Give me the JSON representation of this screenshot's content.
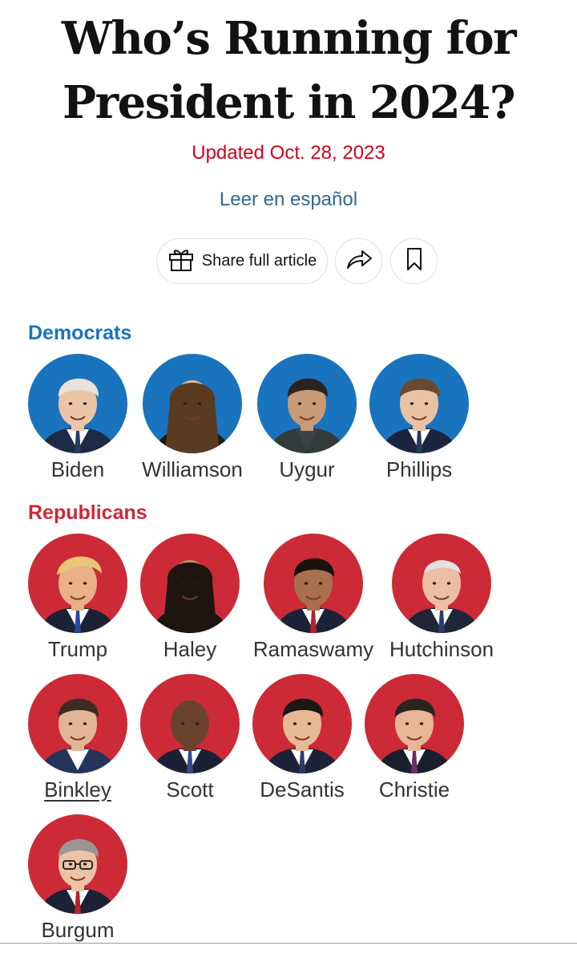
{
  "article": {
    "headline_line1": "Who’s Running for",
    "headline_line2": "President in 2024?",
    "updated": "Updated Oct. 28, 2023",
    "spanish_link": "Leer en español"
  },
  "share": {
    "share_full_label": "Share full article",
    "icons": [
      "gift-icon",
      "share-arrow-icon",
      "bookmark-icon"
    ]
  },
  "colors": {
    "democrat": "#1a73bd",
    "republican": "#cc2a36",
    "updated_text": "#d0021b",
    "link": "#326891"
  },
  "democrats": {
    "heading": "Democrats",
    "candidates": [
      {
        "name": "Biden"
      },
      {
        "name": "Williamson"
      },
      {
        "name": "Uygur"
      },
      {
        "name": "Phillips"
      }
    ]
  },
  "republicans": {
    "heading": "Republicans",
    "candidates": [
      {
        "name": "Trump"
      },
      {
        "name": "Haley"
      },
      {
        "name": "Ramaswamy"
      },
      {
        "name": "Hutchinson"
      },
      {
        "name": "Binkley"
      },
      {
        "name": "Scott"
      },
      {
        "name": "DeSantis"
      },
      {
        "name": "Christie"
      },
      {
        "name": "Burgum"
      }
    ]
  }
}
